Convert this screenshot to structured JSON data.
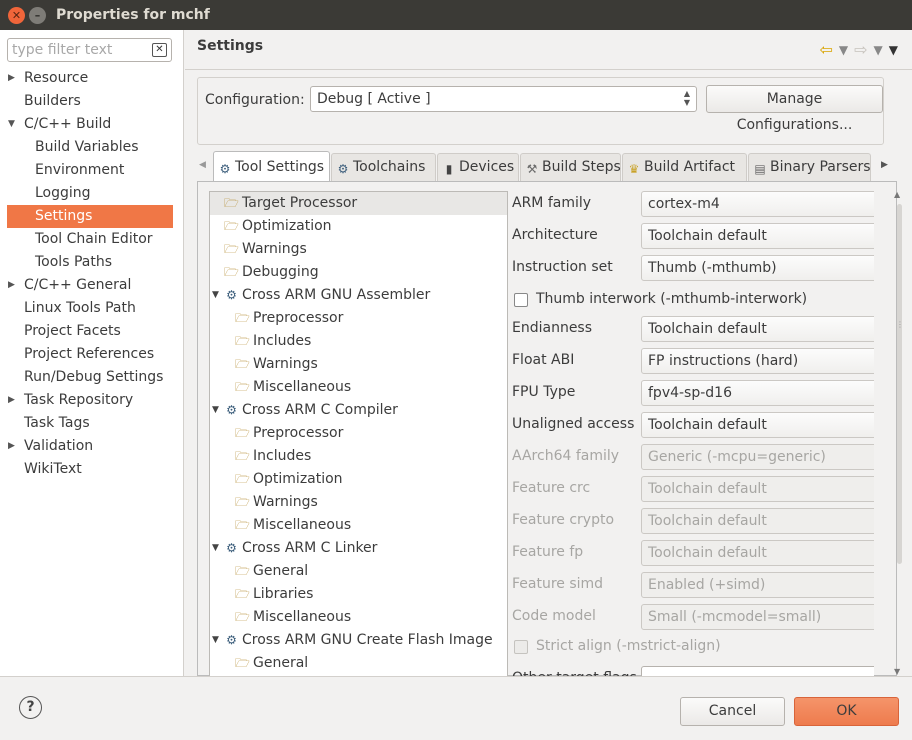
{
  "window": {
    "title": "Properties for mchf",
    "close_glyph": "✕",
    "min_glyph": "–"
  },
  "sidebar": {
    "filter_placeholder": "type filter text",
    "items": [
      {
        "label": "Resource",
        "arrow": "▶",
        "indent": 0
      },
      {
        "label": "Builders",
        "arrow": "",
        "indent": 0
      },
      {
        "label": "C/C++ Build",
        "arrow": "▼",
        "indent": 0
      },
      {
        "label": "Build Variables",
        "arrow": "",
        "indent": 1
      },
      {
        "label": "Environment",
        "arrow": "",
        "indent": 1
      },
      {
        "label": "Logging",
        "arrow": "",
        "indent": 1
      },
      {
        "label": "Settings",
        "arrow": "",
        "indent": 1,
        "selected": true
      },
      {
        "label": "Tool Chain Editor",
        "arrow": "",
        "indent": 1
      },
      {
        "label": "Tools Paths",
        "arrow": "",
        "indent": 1
      },
      {
        "label": "C/C++ General",
        "arrow": "▶",
        "indent": 0
      },
      {
        "label": "Linux Tools Path",
        "arrow": "",
        "indent": 0
      },
      {
        "label": "Project Facets",
        "arrow": "",
        "indent": 0
      },
      {
        "label": "Project References",
        "arrow": "",
        "indent": 0
      },
      {
        "label": "Run/Debug Settings",
        "arrow": "",
        "indent": 0
      },
      {
        "label": "Task Repository",
        "arrow": "▶",
        "indent": 0
      },
      {
        "label": "Task Tags",
        "arrow": "",
        "indent": 0
      },
      {
        "label": "Validation",
        "arrow": "▶",
        "indent": 0
      },
      {
        "label": "WikiText",
        "arrow": "",
        "indent": 0
      }
    ]
  },
  "main": {
    "heading": "Settings",
    "configuration": {
      "label": "Configuration:",
      "value": "Debug  [ Active ]",
      "manage_label": "Manage Configurations..."
    },
    "tabs": [
      {
        "label": "Tool Settings",
        "icon": "tool-settings-icon",
        "active": true
      },
      {
        "label": "Toolchains",
        "icon": "toolchains-icon"
      },
      {
        "label": "Devices",
        "icon": "devices-icon"
      },
      {
        "label": "Build Steps",
        "icon": "build-steps-icon"
      },
      {
        "label": "Build Artifact",
        "icon": "build-artifact-icon"
      },
      {
        "label": "Binary Parsers",
        "icon": "binary-parsers-icon"
      }
    ],
    "tree": [
      {
        "label": "Target Processor",
        "level": 0,
        "type": "folder",
        "selected": true
      },
      {
        "label": "Optimization",
        "level": 0,
        "type": "folder"
      },
      {
        "label": "Warnings",
        "level": 0,
        "type": "folder"
      },
      {
        "label": "Debugging",
        "level": 0,
        "type": "folder"
      },
      {
        "label": "Cross ARM GNU Assembler",
        "level": 0,
        "type": "tool"
      },
      {
        "label": "Preprocessor",
        "level": 1,
        "type": "folder"
      },
      {
        "label": "Includes",
        "level": 1,
        "type": "folder"
      },
      {
        "label": "Warnings",
        "level": 1,
        "type": "folder"
      },
      {
        "label": "Miscellaneous",
        "level": 1,
        "type": "folder"
      },
      {
        "label": "Cross ARM C Compiler",
        "level": 0,
        "type": "tool"
      },
      {
        "label": "Preprocessor",
        "level": 1,
        "type": "folder"
      },
      {
        "label": "Includes",
        "level": 1,
        "type": "folder"
      },
      {
        "label": "Optimization",
        "level": 1,
        "type": "folder"
      },
      {
        "label": "Warnings",
        "level": 1,
        "type": "folder"
      },
      {
        "label": "Miscellaneous",
        "level": 1,
        "type": "folder"
      },
      {
        "label": "Cross ARM C Linker",
        "level": 0,
        "type": "tool"
      },
      {
        "label": "General",
        "level": 1,
        "type": "folder"
      },
      {
        "label": "Libraries",
        "level": 1,
        "type": "folder"
      },
      {
        "label": "Miscellaneous",
        "level": 1,
        "type": "folder"
      },
      {
        "label": "Cross ARM GNU Create Flash Image",
        "level": 0,
        "type": "tool"
      },
      {
        "label": "General",
        "level": 1,
        "type": "folder"
      }
    ],
    "fields": [
      {
        "kind": "select",
        "label": "ARM family",
        "value": "cortex-m4"
      },
      {
        "kind": "select",
        "label": "Architecture",
        "value": "Toolchain default"
      },
      {
        "kind": "select",
        "label": "Instruction set",
        "value": "Thumb (-mthumb)"
      },
      {
        "kind": "check",
        "label": "Thumb interwork (-mthumb-interwork)"
      },
      {
        "kind": "select",
        "label": "Endianness",
        "value": "Toolchain default"
      },
      {
        "kind": "select",
        "label": "Float ABI",
        "value": "FP instructions (hard)"
      },
      {
        "kind": "select",
        "label": "FPU Type",
        "value": "fpv4-sp-d16"
      },
      {
        "kind": "select",
        "label": "Unaligned access",
        "value": "Toolchain default"
      },
      {
        "kind": "select",
        "label": "AArch64 family",
        "value": "Generic (-mcpu=generic)",
        "disabled": true
      },
      {
        "kind": "select",
        "label": "Feature crc",
        "value": "Toolchain default",
        "disabled": true
      },
      {
        "kind": "select",
        "label": "Feature crypto",
        "value": "Toolchain default",
        "disabled": true
      },
      {
        "kind": "select",
        "label": "Feature fp",
        "value": "Toolchain default",
        "disabled": true
      },
      {
        "kind": "select",
        "label": "Feature simd",
        "value": "Enabled (+simd)",
        "disabled": true
      },
      {
        "kind": "select",
        "label": "Code model",
        "value": "Small (-mcmodel=small)",
        "disabled": true
      },
      {
        "kind": "check",
        "label": "Strict align (-mstrict-align)",
        "disabled": true
      },
      {
        "kind": "input",
        "label": "Other target flags",
        "value": ""
      }
    ]
  },
  "footer": {
    "help_glyph": "?",
    "cancel_label": "Cancel",
    "ok_label": "OK"
  }
}
